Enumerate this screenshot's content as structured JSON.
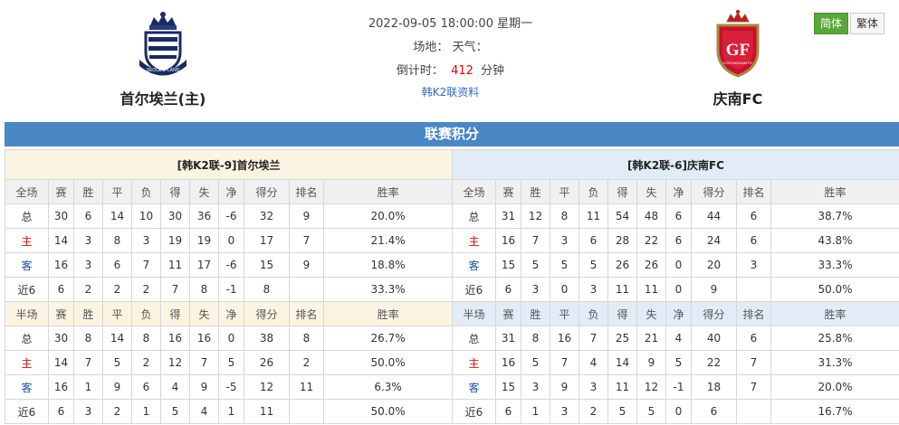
{
  "match": {
    "datetime": "2022-09-05 18:00:00 星期一",
    "venue_label": "场地：",
    "weather_label": "天气：",
    "countdown_label": "倒计时：",
    "countdown_value": "412",
    "countdown_unit": "分钟",
    "league_link": "韩K2联资料"
  },
  "home_team": {
    "name": "首尔埃兰(主)",
    "logo_text": "SEOUL E-LAND"
  },
  "away_team": {
    "name": "庆南FC",
    "logo_text": "GYEONGNAM FC"
  },
  "lang": {
    "simplified": "简体",
    "traditional": "繁体"
  },
  "title": "联赛积分",
  "columns": [
    "赛",
    "胜",
    "平",
    "负",
    "得",
    "失",
    "净",
    "得分",
    "排名",
    "胜率"
  ],
  "full_label": "全场",
  "half_label": "半场",
  "home_panel": {
    "caption": "[韩K2联-9]首尔埃兰",
    "full": [
      {
        "label": "总",
        "cells": [
          "30",
          "6",
          "14",
          "10",
          "30",
          "36",
          "-6",
          "32",
          "9",
          "20.0%"
        ]
      },
      {
        "label": "主",
        "cells": [
          "14",
          "3",
          "8",
          "3",
          "19",
          "19",
          "0",
          "17",
          "7",
          "21.4%"
        ]
      },
      {
        "label": "客",
        "cells": [
          "16",
          "3",
          "6",
          "7",
          "11",
          "17",
          "-6",
          "15",
          "9",
          "18.8%"
        ]
      },
      {
        "label": "近6",
        "cells": [
          "6",
          "2",
          "2",
          "2",
          "7",
          "8",
          "-1",
          "8",
          "",
          "33.3%"
        ]
      }
    ],
    "half": [
      {
        "label": "总",
        "cells": [
          "30",
          "8",
          "14",
          "8",
          "16",
          "16",
          "0",
          "38",
          "8",
          "26.7%"
        ]
      },
      {
        "label": "主",
        "cells": [
          "14",
          "7",
          "5",
          "2",
          "12",
          "7",
          "5",
          "26",
          "2",
          "50.0%"
        ]
      },
      {
        "label": "客",
        "cells": [
          "16",
          "1",
          "9",
          "6",
          "4",
          "9",
          "-5",
          "12",
          "11",
          "6.3%"
        ]
      },
      {
        "label": "近6",
        "cells": [
          "6",
          "3",
          "2",
          "1",
          "5",
          "4",
          "1",
          "11",
          "",
          "50.0%"
        ]
      }
    ]
  },
  "away_panel": {
    "caption": "[韩K2联-6]庆南FC",
    "full": [
      {
        "label": "总",
        "cells": [
          "31",
          "12",
          "8",
          "11",
          "54",
          "48",
          "6",
          "44",
          "6",
          "38.7%"
        ]
      },
      {
        "label": "主",
        "cells": [
          "16",
          "7",
          "3",
          "6",
          "28",
          "22",
          "6",
          "24",
          "6",
          "43.8%"
        ]
      },
      {
        "label": "客",
        "cells": [
          "15",
          "5",
          "5",
          "5",
          "26",
          "26",
          "0",
          "20",
          "3",
          "33.3%"
        ]
      },
      {
        "label": "近6",
        "cells": [
          "6",
          "3",
          "0",
          "3",
          "11",
          "11",
          "0",
          "9",
          "",
          "50.0%"
        ]
      }
    ],
    "half": [
      {
        "label": "总",
        "cells": [
          "31",
          "8",
          "16",
          "7",
          "25",
          "21",
          "4",
          "40",
          "6",
          "25.8%"
        ]
      },
      {
        "label": "主",
        "cells": [
          "16",
          "5",
          "7",
          "4",
          "14",
          "9",
          "5",
          "22",
          "7",
          "31.3%"
        ]
      },
      {
        "label": "客",
        "cells": [
          "15",
          "3",
          "9",
          "3",
          "11",
          "12",
          "-1",
          "18",
          "7",
          "20.0%"
        ]
      },
      {
        "label": "近6",
        "cells": [
          "6",
          "1",
          "3",
          "2",
          "5",
          "5",
          "0",
          "6",
          "",
          "16.7%"
        ]
      }
    ]
  },
  "colors": {
    "title_bar": "#4a87c5",
    "home_label": "#d11111",
    "away_label": "#1c4fae",
    "countdown": "#ee0000",
    "active_lang": "#5aa63a"
  }
}
